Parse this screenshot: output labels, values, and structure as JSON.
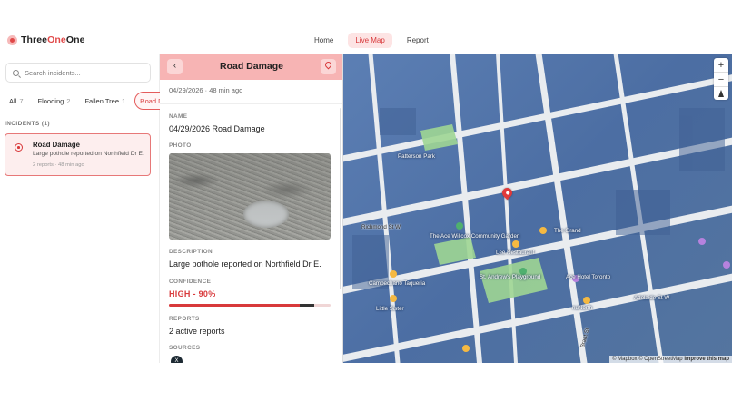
{
  "brand": {
    "name_part1": "Three",
    "name_part2": "One",
    "name_part3": "One"
  },
  "nav": {
    "tabs": [
      {
        "label": "Home"
      },
      {
        "label": "Live Map"
      },
      {
        "label": "Report"
      }
    ],
    "active": "Live Map"
  },
  "sidebar": {
    "search_placeholder": "Search incidents...",
    "filters": [
      {
        "label": "All",
        "count": "7"
      },
      {
        "label": "Flooding",
        "count": "2"
      },
      {
        "label": "Fallen Tree",
        "count": "1"
      },
      {
        "label": "Road Damage",
        "count": ""
      }
    ],
    "section_label": "INCIDENTS (1)",
    "incidents": [
      {
        "title": "Road Damage",
        "description": "Large pothole reported on Northfield Dr E.",
        "meta": "2 reports · 48 min ago"
      }
    ]
  },
  "detail": {
    "title": "Road Damage",
    "back_icon": "chevron-left-icon",
    "locate_icon": "map-pin-icon",
    "time": "04/29/2026 · 48 min ago",
    "name_label": "NAME",
    "name_value": "04/29/2026 Road Damage",
    "photo_label": "PHOTO",
    "description_label": "DESCRIPTION",
    "description_value": "Large pothole reported on Northfield Dr E.",
    "confidence_label": "CONFIDENCE",
    "confidence_value": "HIGH - 90%",
    "confidence_percent": 90,
    "reports_label": "REPORTS",
    "reports_value": "2 active reports",
    "sources_label": "SOURCES",
    "source_avatar": "X"
  },
  "map": {
    "labels": {
      "andrews": "St. Andrew's\nPlayground",
      "ace_hotel": "Ace Hotel Toronto",
      "adelaide": "Adelaide St W",
      "brant": "Brant St",
      "campechano": "Campechano Taqueria",
      "little_sister": "Little Sister",
      "lee": "Lee Restaurant",
      "the_grand": "The Grand",
      "richmond": "Richmond St W",
      "ketchup": "Ketchup",
      "patterson": "Patterson Park",
      "wilcox": "The Ace Willcox\nCommunity Garden",
      "nu": "nuNorth",
      "stevens": "St. Patrick"
    },
    "zoom_in": "+",
    "zoom_out": "−",
    "attribution_prefix": "© Mapbox © OpenStreetMap",
    "attribution_link": "Improve this map"
  },
  "colors": {
    "accent": "#d8393b",
    "header_bg": "#f7b4b4",
    "map_building": "#5878ad",
    "park": "#9fd694"
  }
}
